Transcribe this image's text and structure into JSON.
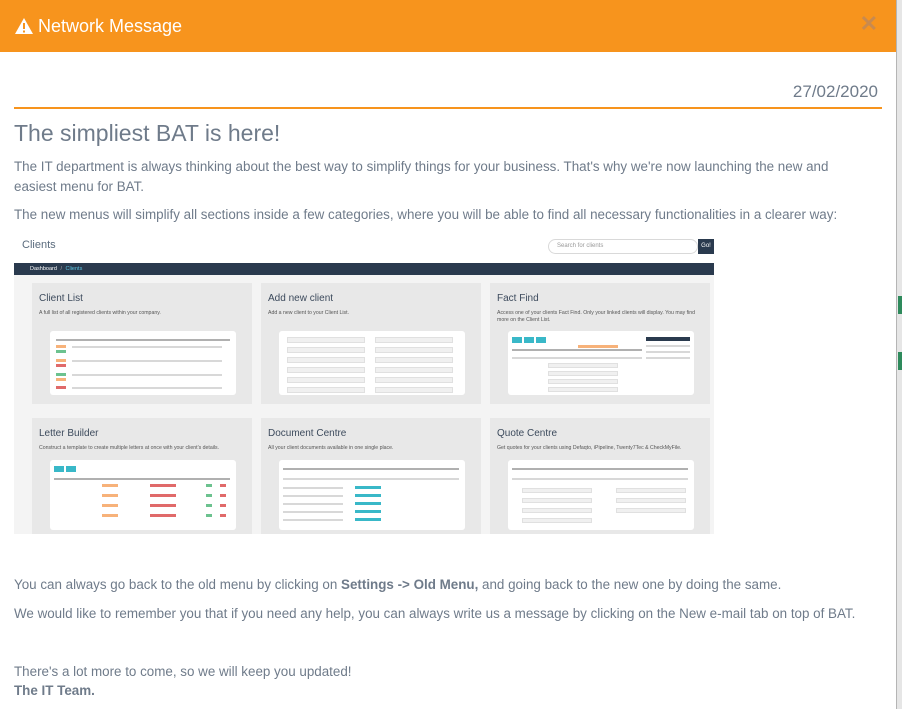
{
  "header": {
    "title": "Network Message",
    "close_symbol": "✕",
    "accent_color": "#f7941d"
  },
  "message": {
    "date": "27/02/2020",
    "heading": "The simpliest BAT is here!",
    "p1": "The IT department is always thinking about the best way to simplify things for your business. That's why we're now launching the new and easiest menu for BAT.",
    "p2": "The new menus will simplify all sections inside a few categories, where you will be able to find all necessary functionalities in a clearer way:",
    "p3_pre": "You can always go back to the old menu by clicking on ",
    "p3_bold": "Settings -> Old Menu,",
    "p3_post": " and going back to the new one by doing the same.",
    "p4_pre": "We would like to remember you that if you need any help, you can always write us a message by clicking on the ",
    "p4_bold": "New e-mail tab",
    "p4_post": " on top of BAT.",
    "p5": "There's a lot more to come, so we will keep you updated!",
    "signature": "The IT Team."
  },
  "screenshot": {
    "title": "Clients",
    "search_placeholder": "Search for clients",
    "go_label": "Go!",
    "breadcrumb_root": "Dashboard",
    "breadcrumb_sep": "/",
    "breadcrumb_current": "Clients",
    "cards": [
      {
        "title": "Client List",
        "desc": "A full list of all registered clients within your company."
      },
      {
        "title": "Add new client",
        "desc": "Add a new client to your Client List."
      },
      {
        "title": "Fact Find",
        "desc": "Access one of your clients Fact Find. Only your linked clients will display. You may find more on the Client List."
      },
      {
        "title": "Letter Builder",
        "desc": "Construct a template to create multiple letters at once with your client's details."
      },
      {
        "title": "Document Centre",
        "desc": "All your client documents available in one single place."
      },
      {
        "title": "Quote Centre",
        "desc": "Get quotes for your clients using Defaqto, iPipeline, Twenty7Tec & CheckMyFile."
      }
    ]
  }
}
